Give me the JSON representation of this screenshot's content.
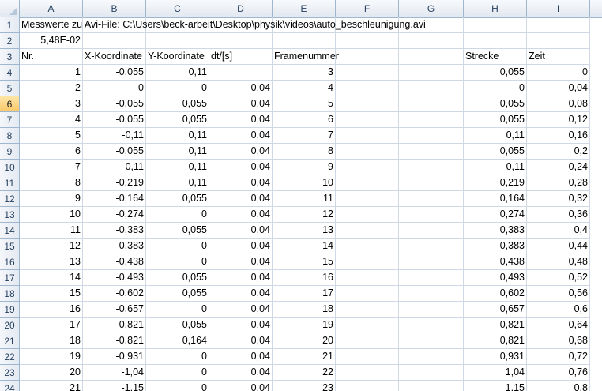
{
  "columns": [
    "A",
    "B",
    "C",
    "D",
    "E",
    "F",
    "G",
    "H",
    "I"
  ],
  "rows": [
    {
      "n": "1",
      "A": "Messwerte zu Avi-File: C:\\Users\\beck-arbeit\\Desktop\\physik\\videos\\auto_beschleunigung.avi",
      "B": "",
      "C": "",
      "D": "",
      "E": "",
      "H": "",
      "I": ""
    },
    {
      "n": "2",
      "A": "5,48E-02",
      "B": "",
      "C": "",
      "D": "",
      "E": "",
      "H": "",
      "I": ""
    },
    {
      "n": "3",
      "A": "Nr.",
      "B": "X-Koordinate",
      "C": "Y-Koordinate",
      "D": "dt/[s]",
      "E": "Framenummer",
      "H": "Strecke",
      "I": "Zeit"
    },
    {
      "n": "4",
      "A": "1",
      "B": "-0,055",
      "C": "0,11",
      "D": "",
      "E": "3",
      "H": "0,055",
      "I": "0"
    },
    {
      "n": "5",
      "A": "2",
      "B": "0",
      "C": "0",
      "D": "0,04",
      "E": "4",
      "H": "0",
      "I": "0,04"
    },
    {
      "n": "6",
      "A": "3",
      "B": "-0,055",
      "C": "0,055",
      "D": "0,04",
      "E": "5",
      "H": "0,055",
      "I": "0,08"
    },
    {
      "n": "7",
      "A": "4",
      "B": "-0,055",
      "C": "0,055",
      "D": "0,04",
      "E": "6",
      "H": "0,055",
      "I": "0,12"
    },
    {
      "n": "8",
      "A": "5",
      "B": "-0,11",
      "C": "0,11",
      "D": "0,04",
      "E": "7",
      "H": "0,11",
      "I": "0,16"
    },
    {
      "n": "9",
      "A": "6",
      "B": "-0,055",
      "C": "0,11",
      "D": "0,04",
      "E": "8",
      "H": "0,055",
      "I": "0,2"
    },
    {
      "n": "10",
      "A": "7",
      "B": "-0,11",
      "C": "0,11",
      "D": "0,04",
      "E": "9",
      "H": "0,11",
      "I": "0,24"
    },
    {
      "n": "11",
      "A": "8",
      "B": "-0,219",
      "C": "0,11",
      "D": "0,04",
      "E": "10",
      "H": "0,219",
      "I": "0,28"
    },
    {
      "n": "12",
      "A": "9",
      "B": "-0,164",
      "C": "0,055",
      "D": "0,04",
      "E": "11",
      "H": "0,164",
      "I": "0,32"
    },
    {
      "n": "13",
      "A": "10",
      "B": "-0,274",
      "C": "0",
      "D": "0,04",
      "E": "12",
      "H": "0,274",
      "I": "0,36"
    },
    {
      "n": "14",
      "A": "11",
      "B": "-0,383",
      "C": "0,055",
      "D": "0,04",
      "E": "13",
      "H": "0,383",
      "I": "0,4"
    },
    {
      "n": "15",
      "A": "12",
      "B": "-0,383",
      "C": "0",
      "D": "0,04",
      "E": "14",
      "H": "0,383",
      "I": "0,44"
    },
    {
      "n": "16",
      "A": "13",
      "B": "-0,438",
      "C": "0",
      "D": "0,04",
      "E": "15",
      "H": "0,438",
      "I": "0,48"
    },
    {
      "n": "17",
      "A": "14",
      "B": "-0,493",
      "C": "0,055",
      "D": "0,04",
      "E": "16",
      "H": "0,493",
      "I": "0,52"
    },
    {
      "n": "18",
      "A": "15",
      "B": "-0,602",
      "C": "0,055",
      "D": "0,04",
      "E": "17",
      "H": "0,602",
      "I": "0,56"
    },
    {
      "n": "19",
      "A": "16",
      "B": "-0,657",
      "C": "0",
      "D": "0,04",
      "E": "18",
      "H": "0,657",
      "I": "0,6"
    },
    {
      "n": "20",
      "A": "17",
      "B": "-0,821",
      "C": "0,055",
      "D": "0,04",
      "E": "19",
      "H": "0,821",
      "I": "0,64"
    },
    {
      "n": "21",
      "A": "18",
      "B": "-0,821",
      "C": "0,164",
      "D": "0,04",
      "E": "20",
      "H": "0,821",
      "I": "0,68"
    },
    {
      "n": "22",
      "A": "19",
      "B": "-0,931",
      "C": "0",
      "D": "0,04",
      "E": "21",
      "H": "0,931",
      "I": "0,72"
    },
    {
      "n": "23",
      "A": "20",
      "B": "-1,04",
      "C": "0",
      "D": "0,04",
      "E": "22",
      "H": "1,04",
      "I": "0,76"
    },
    {
      "n": "24",
      "A": "21",
      "B": "-1,15",
      "C": "0",
      "D": "0,04",
      "E": "23",
      "H": "1,15",
      "I": "0,8"
    }
  ],
  "selected_row": "6",
  "colors": {
    "header_border": "#9eb6ce",
    "grid": "#d0d7e5",
    "selected_header": "#f9c86a"
  }
}
